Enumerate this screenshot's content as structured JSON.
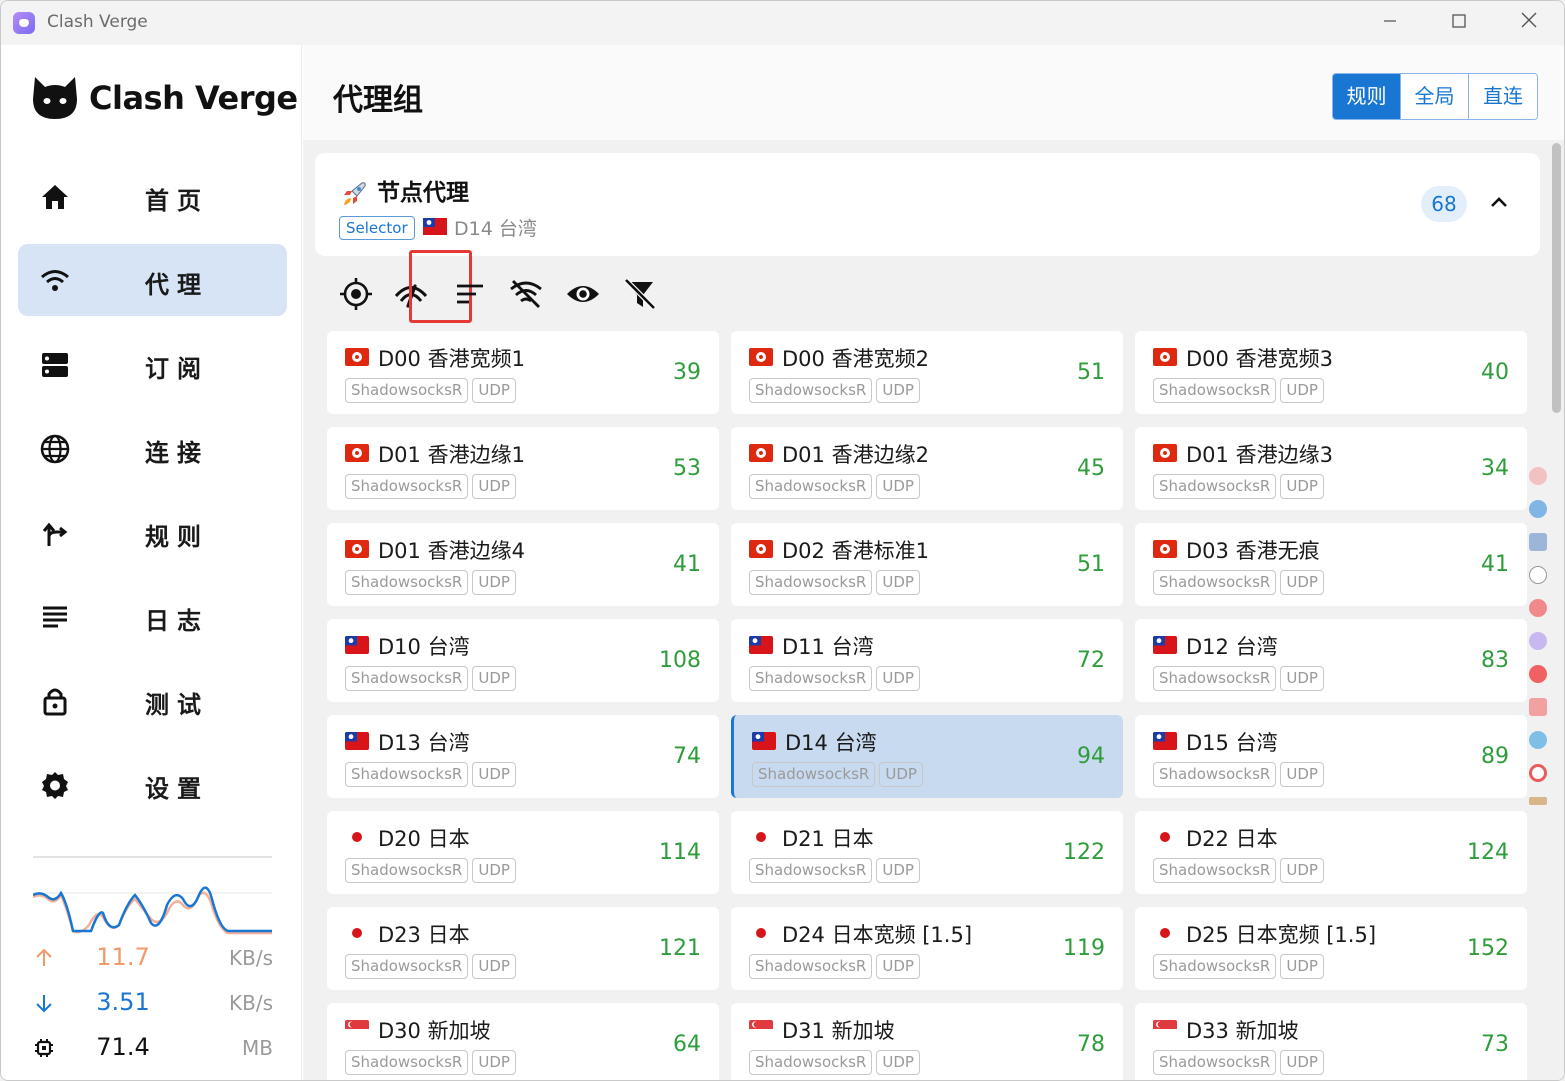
{
  "app": {
    "title": "Clash Verge",
    "brand": "Clash Verge"
  },
  "nav": [
    {
      "label": "首页",
      "icon": "home-icon"
    },
    {
      "label": "代理",
      "icon": "wifi-icon",
      "active": true
    },
    {
      "label": "订阅",
      "icon": "storage-icon"
    },
    {
      "label": "连接",
      "icon": "globe-icon"
    },
    {
      "label": "规则",
      "icon": "fork-icon"
    },
    {
      "label": "日志",
      "icon": "list-icon"
    },
    {
      "label": "测试",
      "icon": "lock-icon"
    },
    {
      "label": "设置",
      "icon": "gear-icon"
    }
  ],
  "stats": {
    "upload": {
      "value": "11.7",
      "unit": "KB/s",
      "color": "#f29a6b"
    },
    "download": {
      "value": "3.51",
      "unit": "KB/s",
      "color": "#1976d2"
    },
    "memory": {
      "value": "71.4",
      "unit": "MB"
    }
  },
  "header": {
    "title": "代理组",
    "modes": [
      "规则",
      "全局",
      "直连"
    ],
    "active_mode": "规则"
  },
  "group": {
    "name": "节点代理",
    "type": "Selector",
    "current": "D14 台湾",
    "count": "68"
  },
  "toolbar": [
    "locate-icon",
    "speed-test-icon",
    "sort-icon",
    "no-wifi-filter-icon",
    "eye-icon",
    "filter-off-icon"
  ],
  "nodes": [
    {
      "name": "D00 香港宽频1",
      "flag": "hk",
      "delay": "39"
    },
    {
      "name": "D00 香港宽频2",
      "flag": "hk",
      "delay": "51"
    },
    {
      "name": "D00 香港宽频3",
      "flag": "hk",
      "delay": "40"
    },
    {
      "name": "D01 香港边缘1",
      "flag": "hk",
      "delay": "53"
    },
    {
      "name": "D01 香港边缘2",
      "flag": "hk",
      "delay": "45"
    },
    {
      "name": "D01 香港边缘3",
      "flag": "hk",
      "delay": "34"
    },
    {
      "name": "D01 香港边缘4",
      "flag": "hk",
      "delay": "41"
    },
    {
      "name": "D02 香港标准1",
      "flag": "hk",
      "delay": "51"
    },
    {
      "name": "D03 香港无痕",
      "flag": "hk",
      "delay": "41"
    },
    {
      "name": "D10 台湾",
      "flag": "tw",
      "delay": "108"
    },
    {
      "name": "D11 台湾",
      "flag": "tw",
      "delay": "72"
    },
    {
      "name": "D12 台湾",
      "flag": "tw",
      "delay": "83"
    },
    {
      "name": "D13 台湾",
      "flag": "tw",
      "delay": "74"
    },
    {
      "name": "D14 台湾",
      "flag": "tw",
      "delay": "94",
      "selected": true
    },
    {
      "name": "D15 台湾",
      "flag": "tw",
      "delay": "89"
    },
    {
      "name": "D20 日本",
      "flag": "jp",
      "delay": "114"
    },
    {
      "name": "D21 日本",
      "flag": "jp",
      "delay": "122"
    },
    {
      "name": "D22 日本",
      "flag": "jp",
      "delay": "124"
    },
    {
      "name": "D23 日本",
      "flag": "jp",
      "delay": "121"
    },
    {
      "name": "D24 日本宽频 [1.5]",
      "flag": "jp",
      "delay": "119"
    },
    {
      "name": "D25 日本宽频 [1.5]",
      "flag": "jp",
      "delay": "152"
    },
    {
      "name": "D30 新加坡",
      "flag": "sg",
      "delay": "64"
    },
    {
      "name": "D31 新加坡",
      "flag": "sg",
      "delay": "78"
    },
    {
      "name": "D33 新加坡",
      "flag": "sg",
      "delay": "73"
    }
  ],
  "node_tags": [
    "ShadowsocksR",
    "UDP"
  ],
  "colors": {
    "accent": "#1976d2",
    "delay": "#2e9d3a",
    "selected_bg": "#c8daef"
  }
}
